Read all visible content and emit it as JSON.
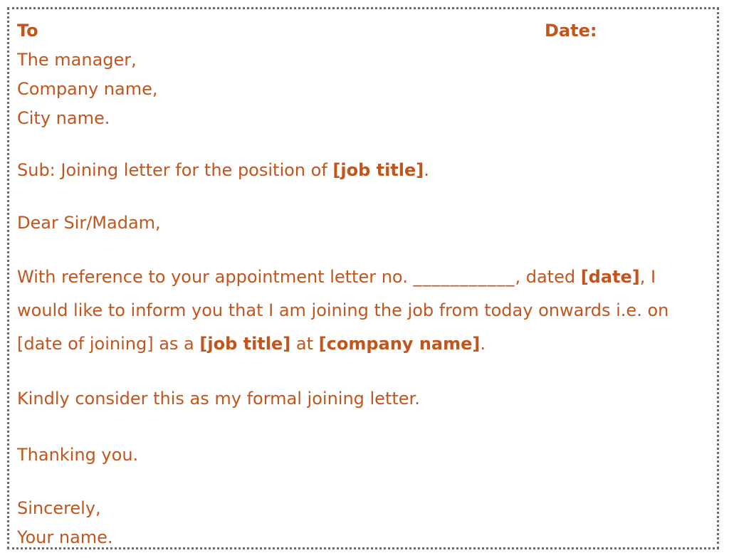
{
  "letter": {
    "to_label": "To",
    "date_label": "Date:",
    "recipient": {
      "line1": "The manager,",
      "line2": "Company name,",
      "line3": "City name."
    },
    "subject": {
      "prefix": "Sub: Joining letter for the position of ",
      "job_title": "[job title]",
      "suffix": "."
    },
    "salutation": "Dear Sir/Madam,",
    "body": {
      "part1": "With reference to your appointment letter no. ",
      "blank": "___________",
      "part2": ", dated ",
      "date": "[date]",
      "part3": ", I would like to inform you that I am joining the job from today onwards i.e. on [date of joining] as a ",
      "job_title": "[job title]",
      "part4": " at ",
      "company_name": "[company name]",
      "part5": "."
    },
    "closing": "Kindly consider this as my formal joining letter.",
    "thanks": "Thanking you.",
    "signoff": {
      "line1": "Sincerely,",
      "line2": "Your name."
    }
  },
  "colors": {
    "text": "#c0561d",
    "border": "#6b6b6b"
  }
}
